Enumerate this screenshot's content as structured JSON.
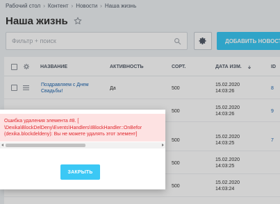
{
  "breadcrumb": {
    "items": [
      "Рабочий стол",
      "Контент",
      "Новости",
      "Наша жизнь"
    ],
    "separator": "›"
  },
  "header": {
    "title": "Наша жизнь",
    "favorite_icon": "star-icon"
  },
  "toolbar": {
    "filter_placeholder": "Фильтр + поиск",
    "settings_icon": "gear-icon",
    "add_label": "ДОБАВИТЬ НОВОСТЬ"
  },
  "grid": {
    "columns": [
      "НАЗВАНИЕ",
      "АКТИВНОСТЬ",
      "СОРТ.",
      "ДАТА ИЗМ.",
      "ID"
    ],
    "rows": [
      {
        "name": "Поздравляем с Днем Свадьбы!",
        "active": "Да",
        "sort": "500",
        "date": "15.02.2020",
        "time": "14:03:26",
        "id": "8"
      },
      {
        "name": "",
        "active": "",
        "sort": "500",
        "date": "15.02.2020",
        "time": "14:03:26",
        "id": "9"
      },
      {
        "name": "",
        "active": "",
        "sort": "500",
        "date": "15.02.2020",
        "time": "14:03:25",
        "id": "7"
      },
      {
        "name": "",
        "active": "",
        "sort": "500",
        "date": "15.02.2020",
        "time": "14:03:25",
        "id": ""
      },
      {
        "name": "",
        "active": "",
        "sort": "500",
        "date": "15.02.2020",
        "time": "14:03:24",
        "id": ""
      }
    ]
  },
  "dialog": {
    "error_text": "Ошибка удаления элемента #8. [\n\\Dexika\\BlockDelDeny\\Events\\Handlers\\IBlockHandler::OnBefor\n(dexika.blockdeldeny): Вы не можете удалять этот элемент]",
    "close_label": "ЗАКРЫТЬ"
  },
  "colors": {
    "accent": "#3bc8f5",
    "error": "#e0272d",
    "error_bg": "#fde2e2",
    "link": "#2067b0"
  }
}
